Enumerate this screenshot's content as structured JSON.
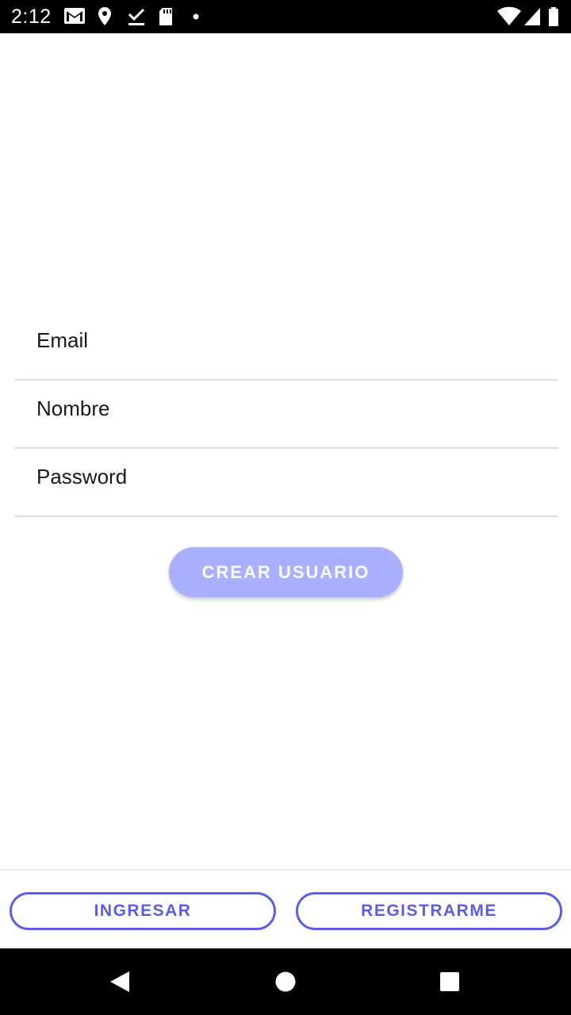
{
  "status_bar": {
    "time": "2:12",
    "icons": [
      "gmail-icon",
      "location-icon",
      "download-done-icon",
      "sd-card-icon",
      "dot-icon",
      "wifi-icon",
      "signal-icon",
      "battery-icon"
    ]
  },
  "form": {
    "email_label": "Email",
    "name_label": "Nombre",
    "password_label": "Password",
    "create_button_label": "CREAR USUARIO"
  },
  "bottom_actions": {
    "login_label": "INGRESAR",
    "register_label": "REGISTRARME"
  },
  "colors": {
    "accent": "#5a5ee6",
    "create_button_bg": "#a9b0ff",
    "status_bar_bg": "#000000",
    "nav_bar_bg": "#000000"
  },
  "nav_bar": {
    "icons": [
      "back-icon",
      "home-icon",
      "recents-icon"
    ]
  }
}
